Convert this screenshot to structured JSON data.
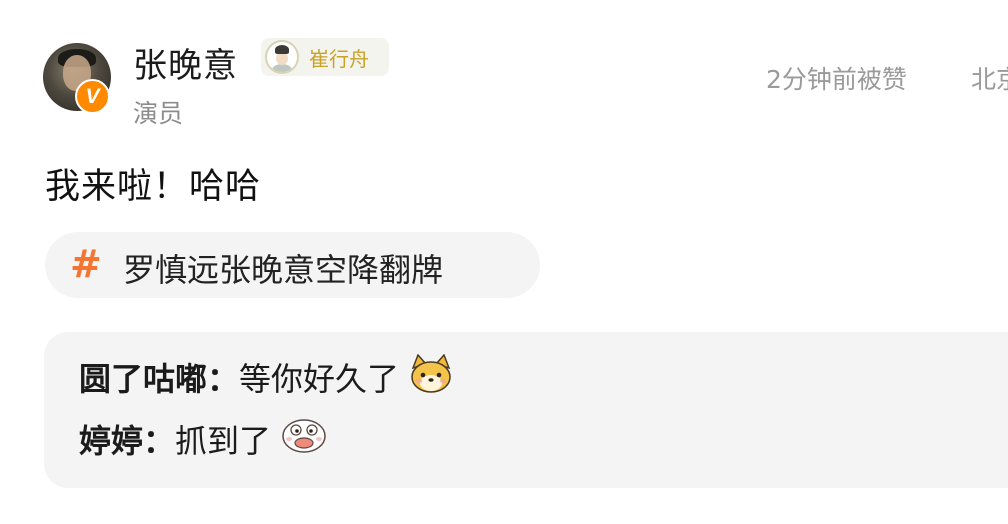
{
  "post": {
    "author": {
      "name": "张晚意",
      "verified_badge": "V",
      "role_tag": {
        "name": "崔行舟",
        "icon": "character-avatar-icon"
      },
      "subtitle": "演员"
    },
    "meta": {
      "timestamp": "2分钟前被赞",
      "location": "北京"
    },
    "content": "我来啦！哈哈",
    "topic": {
      "hash": "#",
      "label": "罗慎远张晚意空降翻牌"
    },
    "comments": [
      {
        "author": "圆了咕嘟：",
        "text": "等你好久了",
        "emoji": "shiba-dog-face-icon"
      },
      {
        "author": "婷婷：",
        "text": "抓到了",
        "emoji": "duck-face-icon"
      }
    ],
    "colors": {
      "accent_orange": "#f47432",
      "verified_orange": "#ff8a00",
      "role_gold": "#c9a227",
      "muted_text": "#9a9a9a",
      "panel_bg": "#f4f4f4"
    }
  }
}
